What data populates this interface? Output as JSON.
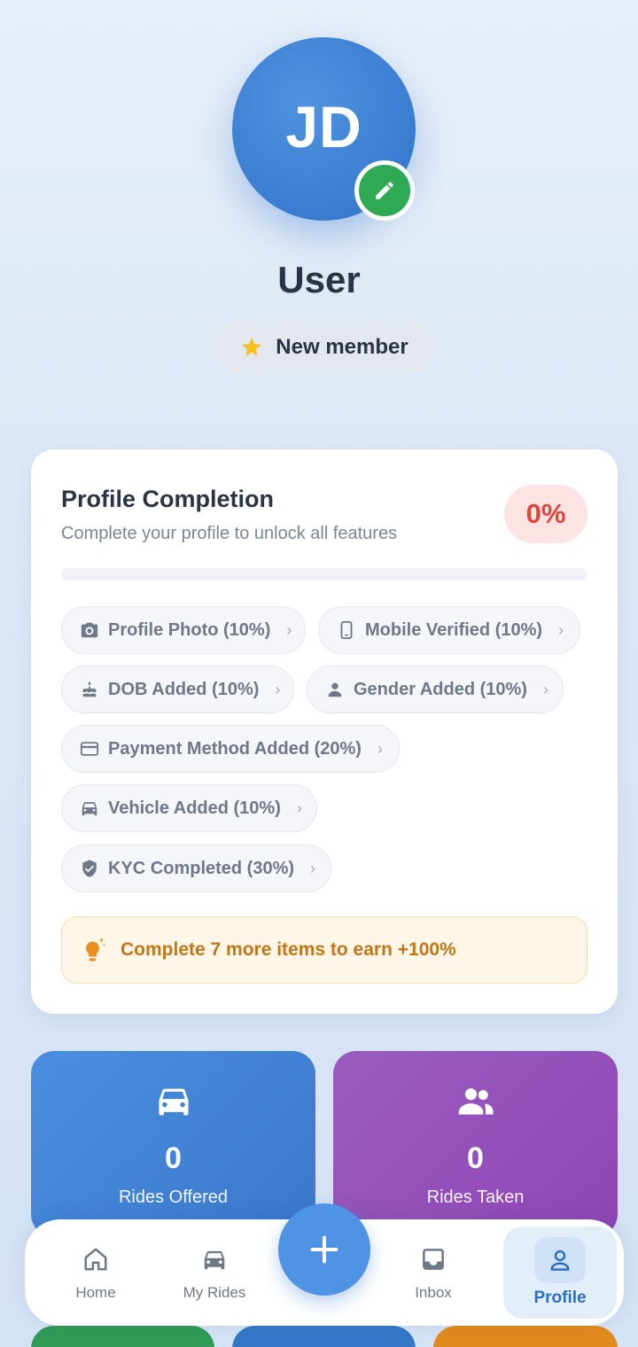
{
  "profile": {
    "initials": "JD",
    "name": "User",
    "badge_label": "New member"
  },
  "completion": {
    "title": "Profile Completion",
    "subtitle": "Complete your profile to unlock all features",
    "percent_label": "0%",
    "progress_percent": 0,
    "chips": [
      {
        "label": "Profile Photo (10%)",
        "icon": "camera-icon"
      },
      {
        "label": "Mobile Verified (10%)",
        "icon": "phone-icon"
      },
      {
        "label": "DOB Added (10%)",
        "icon": "cake-icon"
      },
      {
        "label": "Gender Added (10%)",
        "icon": "person-icon"
      },
      {
        "label": "Payment Method Added (20%)",
        "icon": "credit-card-icon"
      },
      {
        "label": "Vehicle Added (10%)",
        "icon": "car-icon"
      },
      {
        "label": "KYC Completed (30%)",
        "icon": "shield-check-icon"
      }
    ],
    "tip": "Complete 7 more items to earn +100%"
  },
  "stats": [
    {
      "value": "0",
      "label": "Rides Offered",
      "icon": "car-icon",
      "color": "#3f82d6"
    },
    {
      "value": "0",
      "label": "Rides Taken",
      "icon": "people-icon",
      "color": "#9350bb"
    }
  ],
  "nav": {
    "home": "Home",
    "my_rides": "My Rides",
    "inbox": "Inbox",
    "profile": "Profile"
  },
  "colors": {
    "primary": "#3f82d6",
    "success": "#2eaa55",
    "danger": "#e0453a",
    "warning": "#c27618"
  }
}
